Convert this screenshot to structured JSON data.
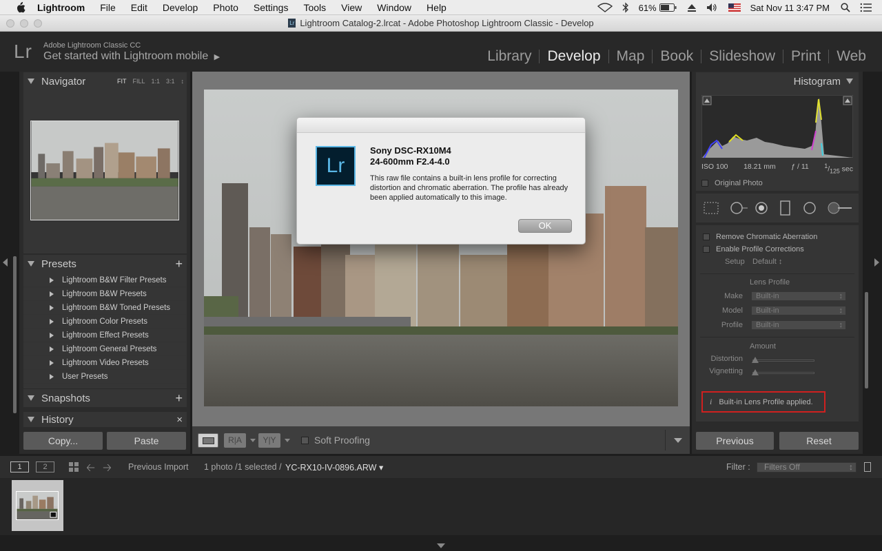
{
  "menubar": {
    "app": "Lightroom",
    "items": [
      "File",
      "Edit",
      "Develop",
      "Photo",
      "Settings",
      "Tools",
      "View",
      "Window",
      "Help"
    ],
    "battery": "61%",
    "clock": "Sat Nov 11  3:47 PM"
  },
  "window": {
    "title": "Lightroom Catalog-2.lrcat - Adobe Photoshop Lightroom Classic - Develop"
  },
  "identity": {
    "logo": "Lr",
    "product": "Adobe Lightroom Classic CC",
    "mobile": "Get started with Lightroom mobile"
  },
  "modules": [
    "Library",
    "Develop",
    "Map",
    "Book",
    "Slideshow",
    "Print",
    "Web"
  ],
  "navigator": {
    "title": "Navigator",
    "zoom": [
      "FIT",
      "FILL",
      "1:1",
      "3:1"
    ]
  },
  "presets": {
    "title": "Presets",
    "items": [
      "Lightroom B&W Filter Presets",
      "Lightroom B&W Presets",
      "Lightroom B&W Toned Presets",
      "Lightroom Color Presets",
      "Lightroom Effect Presets",
      "Lightroom General Presets",
      "Lightroom Video Presets",
      "User Presets"
    ]
  },
  "snapshots": {
    "title": "Snapshots"
  },
  "history": {
    "title": "History"
  },
  "left_buttons": {
    "copy": "Copy...",
    "paste": "Paste"
  },
  "toolbar": {
    "soft_proofing": "Soft Proofing"
  },
  "histogram": {
    "title": "Histogram",
    "iso": "ISO 100",
    "focal": "18.21 mm",
    "aperture": "ƒ / 11",
    "shutter_num": "1",
    "shutter_den": "125",
    "shutter_unit": "sec",
    "original_photo": "Original Photo"
  },
  "lens": {
    "remove_ca": "Remove Chromatic Aberration",
    "enable_profile": "Enable Profile Corrections",
    "setup_label": "Setup",
    "setup_value": "Default",
    "lens_profile_header": "Lens Profile",
    "make_label": "Make",
    "model_label": "Model",
    "profile_label": "Profile",
    "make_value": "Built-in",
    "model_value": "Built-in",
    "profile_value": "Built-in",
    "amount_header": "Amount",
    "distortion_label": "Distortion",
    "vignetting_label": "Vignetting",
    "info": "Built-in Lens Profile applied."
  },
  "right_buttons": {
    "previous": "Previous",
    "reset": "Reset"
  },
  "filmstrip": {
    "view1": "1",
    "view2": "2",
    "source": "Previous Import",
    "count": "1 photo /1 selected /",
    "filename": "YC-RX10-IV-0896.ARW",
    "filter_label": "Filter :",
    "filter_value": "Filters Off"
  },
  "dialog": {
    "logo": "Lr",
    "camera": "Sony DSC-RX10M4",
    "lens": "24-600mm F2.4-4.0",
    "message": "This raw file contains a built-in lens profile for correcting distortion and chromatic aberration. The profile has already been applied automatically to this image.",
    "ok": "OK"
  }
}
